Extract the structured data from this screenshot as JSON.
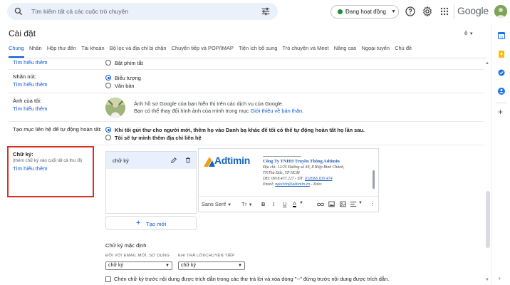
{
  "search": {
    "placeholder": "Tìm kiếm tất cả các cuộc trò chuyện"
  },
  "status": {
    "label": "Đang hoạt động",
    "color": "#1e8e3e"
  },
  "brand": {
    "name": "Google"
  },
  "icons": [
    "search-icon",
    "tune-icon",
    "help-icon",
    "gear-icon",
    "apps-grid-icon",
    "avatar",
    "keyboard-icon",
    "pencil-icon",
    "trash-icon",
    "plus-icon",
    "bold-icon",
    "italic-icon",
    "underline-icon",
    "text-color-icon",
    "link-icon",
    "image-icon",
    "insert-image-icon",
    "align-icon",
    "more-icon"
  ],
  "page": {
    "title": "Cài đặt",
    "lang_indicator": "ê"
  },
  "tabs": [
    {
      "label": "Chung",
      "active": true
    },
    {
      "label": "Nhãn"
    },
    {
      "label": "Hộp thư đến"
    },
    {
      "label": "Tài khoản"
    },
    {
      "label": "Bộ lọc và địa chỉ bị chặn"
    },
    {
      "label": "Chuyển tiếp và POP/IMAP"
    },
    {
      "label": "Tiện ích bổ sung"
    },
    {
      "label": "Trò chuyện và Meet"
    },
    {
      "label": "Nâng cao"
    },
    {
      "label": "Ngoại tuyến"
    },
    {
      "label": "Chủ đề"
    }
  ],
  "settings": {
    "shortcuts": {
      "learn_more": "Tìm hiểu thêm",
      "option_on": "Bật phím tắt"
    },
    "button_labels": {
      "label": "Nhãn nút:",
      "learn_more": "Tìm hiểu thêm",
      "opt_icons": "Biểu tượng",
      "opt_text": "Văn bản"
    },
    "my_picture": {
      "label": "Ảnh của tôi:",
      "learn_more": "Tìm hiểu thêm",
      "line1": "Ảnh hồ sơ Google của bạn hiển thị trên các dịch vụ của Google.",
      "line2": "Bạn có thể thay đổi hình ảnh của mình trong mục",
      "about_me_link": "Giới thiệu về bản thân."
    },
    "autocomplete": {
      "label": "Tạo mục liên hệ để tự động hoàn tất:",
      "opt_auto": "Khi tôi gửi thư cho người mới, thêm họ vào Danh bạ khác để tôi có thể tự động hoàn tất họ lần sau.",
      "opt_manual": "Tôi sẽ tự mình thêm địa chỉ liên hệ"
    },
    "signature": {
      "label": "Chữ ký:",
      "hint": "(thêm chữ ký vào cuối tất cả thư đi)",
      "learn_more": "Tìm hiểu thêm",
      "items": [
        {
          "name": "chữ ký"
        }
      ],
      "new_button": "Tạo mới",
      "preview": {
        "logo": "Adtimin",
        "dashes": "------------------------------------",
        "company": "Công Ty TNHH Truyền Thông Adtimin",
        "address1": "Địa chỉ: 12/25 Đường số 49, P.Hiệp Bình Chánh,",
        "address2": "TP.Thủ Đức, TP HCM",
        "phone": "DĐ: 0918.437.227 -  ĐT:",
        "phone_link": "(028)66.830.474",
        "email_prefix": "Email:",
        "email": "ngoctim@adtimin.vn",
        "email_suffix": " -  Zalo:"
      },
      "toolbar": {
        "font": "Sans Serif"
      },
      "defaults": {
        "title": "Chữ ký mặc định",
        "new_label": "ĐỐI VỚI EMAIL MỚI, SỬ DỤNG",
        "reply_label": "KHI TRẢ LỜI/CHUYỂN TIẾP",
        "new_value": "chữ ký",
        "reply_value": "chữ ký"
      },
      "insert_before_quote": "Chèn chữ ký trước nội dung được trích dẫn trong các thư trả lời và xóa dòng \"--\" đứng trước nội dung được trích dẫn."
    }
  },
  "colors": {
    "accent": "#0b57d0",
    "highlight": "#d93025"
  }
}
